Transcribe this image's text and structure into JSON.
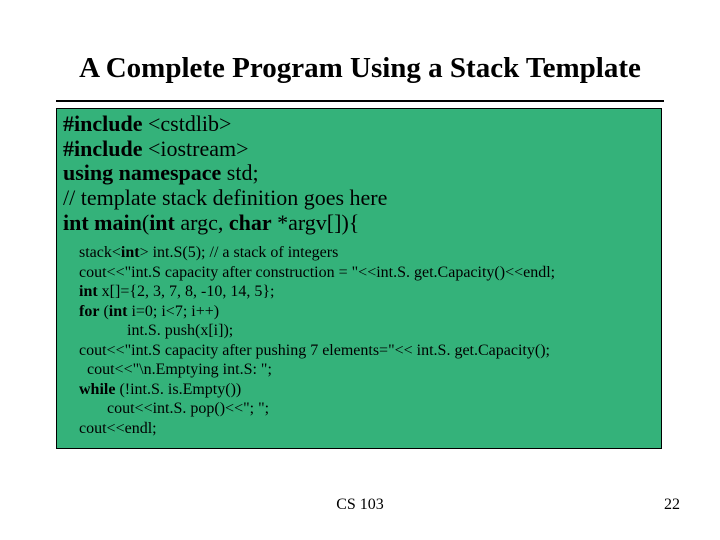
{
  "title": "A Complete Program Using a Stack Template",
  "code_big": {
    "l1_a": "#include",
    "l1_b": "<cstdlib>",
    "l2_a": "#include",
    "l2_b": "<iostream>",
    "l3_a": "using namespace",
    "l3_b": "std;",
    "l4": "// template stack definition goes here",
    "l5_a": "int main",
    "l5_b": "(",
    "l5_c": "int",
    "l5_d": "argc,",
    "l5_e": "char",
    "l5_f": "*argv[]){"
  },
  "code_small": {
    "s1_a": "stack<",
    "s1_b": "int",
    "s1_c": "> int.S(5);    // a stack of integers",
    "s2": "cout<<\"int.S capacity after construction = \"<<int.S. get.Capacity()<<endl;",
    "s3_a": "int",
    "s3_b": "x[]={2, 3, 7, 8, -10, 14, 5};",
    "s4_a": "for",
    "s4_b": "(",
    "s4_c": "int",
    "s4_d": "i=0; i<7; i++)",
    "s5": "int.S. push(x[i]);",
    "s6": "cout<<\"int.S capacity after pushing 7 elements=\"<< int.S. get.Capacity();",
    "s7": "cout<<\"\\n.Emptying int.S: \";",
    "s8_a": "while",
    "s8_b": "(!int.S. is.Empty())",
    "s9": "cout<<int.S. pop()<<\"; \";",
    "s10": "cout<<endl;"
  },
  "footer": {
    "class": "CS 103",
    "page": "22"
  }
}
